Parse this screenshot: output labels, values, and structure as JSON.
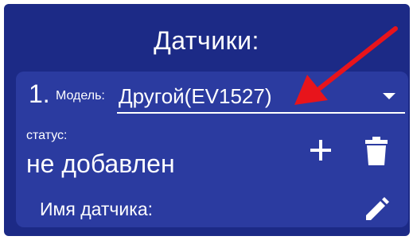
{
  "header": {
    "title": "Датчики:"
  },
  "sensor": {
    "index": "1.",
    "model_label": "Модель:",
    "model_value": "Другой(EV1527)",
    "status_label": "статус:",
    "status_value": "не добавлен",
    "name_label": "Имя датчика:"
  },
  "icons": {
    "dropdown": "chevron-down-icon",
    "add": "plus-icon",
    "delete": "trash-icon",
    "edit": "pencil-icon",
    "annotation": "red-arrow-annotation"
  },
  "colors": {
    "background": "#1c2a86",
    "card": "#2b3ba0",
    "text": "#ffffff",
    "arrow": "#e8141b"
  }
}
